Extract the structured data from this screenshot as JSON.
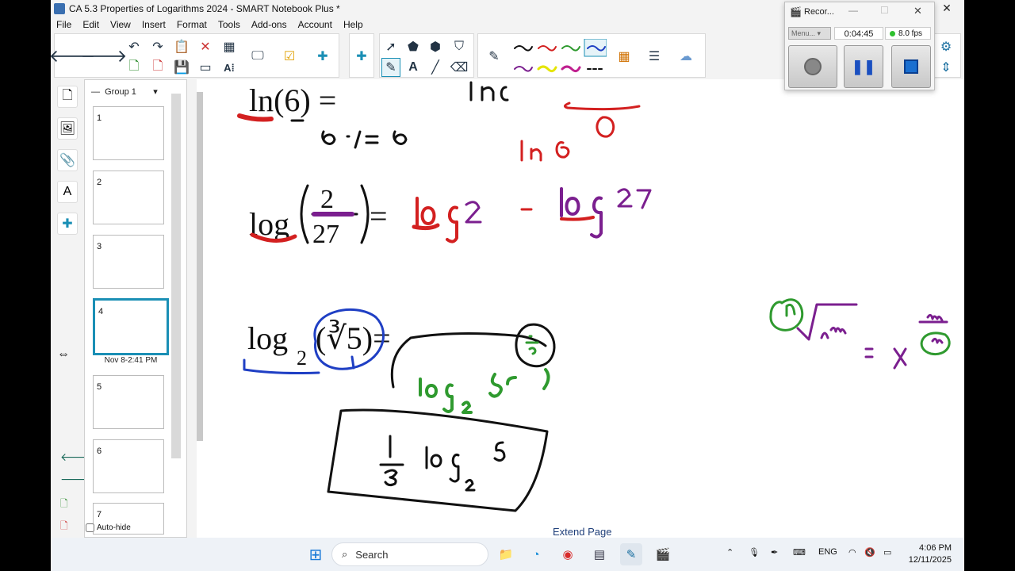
{
  "window": {
    "title": "CA 5.3 Properties of Logarithms 2024 - SMART Notebook Plus *"
  },
  "menu": [
    "File",
    "Edit",
    "View",
    "Insert",
    "Format",
    "Tools",
    "Add-ons",
    "Account",
    "Help"
  ],
  "pages_panel": {
    "group_label": "Group 1",
    "thumbnails": [
      {
        "number": "1"
      },
      {
        "number": "2"
      },
      {
        "number": "3"
      },
      {
        "number": "4",
        "active": true,
        "caption": "Nov 8-2:41 PM"
      },
      {
        "number": "5"
      },
      {
        "number": "6"
      },
      {
        "number": "7"
      }
    ],
    "auto_hide_label": "Auto-hide"
  },
  "canvas": {
    "extend_label": "Extend Page"
  },
  "recorder": {
    "title": "Recor...",
    "menu": "Menu...",
    "time": "0:04:45",
    "fps": "8.0 fps"
  },
  "taskbar": {
    "search_placeholder": "Search",
    "lang": "ENG",
    "time": "4:06 PM",
    "date": "12/11/2025"
  },
  "colors": {
    "red": "#d32020",
    "purple": "#7b1f8f",
    "green": "#2f9a2f",
    "blue": "#1f3fc4",
    "black": "#111111"
  }
}
